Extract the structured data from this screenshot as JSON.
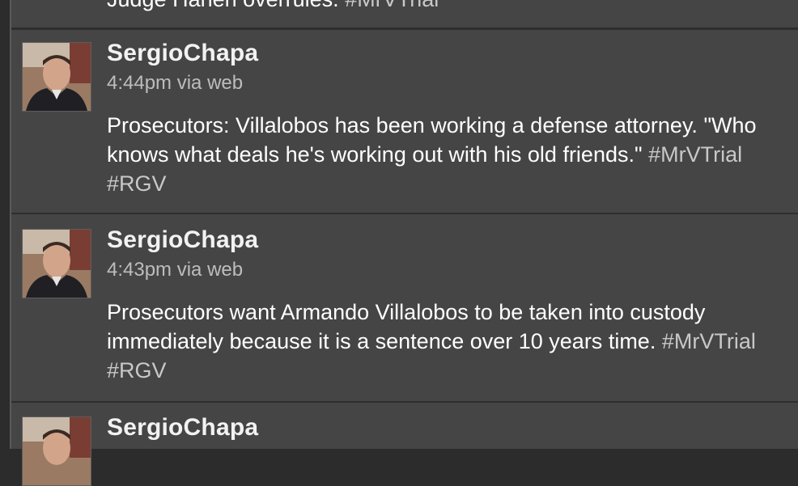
{
  "top_partial": {
    "text": "Judge Hanen overrules.",
    "hashtags": "#MrVTrial"
  },
  "tweets": [
    {
      "username": "SergioChapa",
      "time": "4:44pm via web",
      "text": "Prosecutors: Villalobos has been working a defense attorney. \"Who knows what deals he's working out with his old friends.\"",
      "hashtags": [
        "#MrVTrial",
        "#RGV"
      ]
    },
    {
      "username": "SergioChapa",
      "time": "4:43pm via web",
      "text": "Prosecutors want Armando Villalobos to be taken into custody immediately because it is a sentence over 10 years time.",
      "hashtags": [
        "#MrVTrial",
        "#RGV"
      ]
    },
    {
      "username": "SergioChapa"
    }
  ]
}
